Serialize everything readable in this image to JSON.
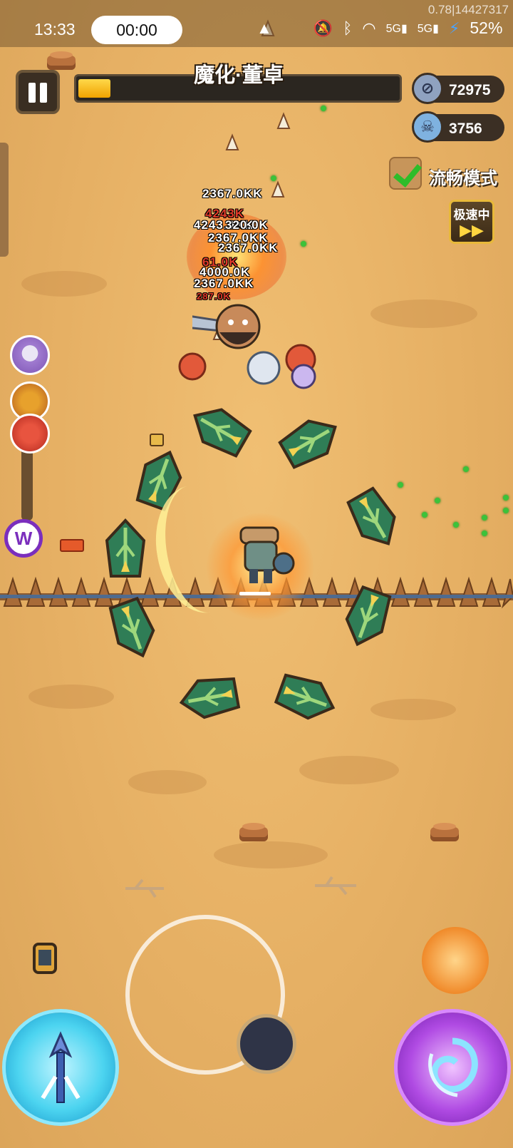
{
  "status_bar": {
    "time": "13:33",
    "recording_timer": "00:00",
    "battery": "52%",
    "debug": "0.78|14427317",
    "icons": [
      "app-icon",
      "mute-icon",
      "bluetooth-icon",
      "wifi-icon",
      "signal-5g-icon",
      "signal-5g-icon",
      "charging-icon"
    ]
  },
  "hud": {
    "boss_name": "魔化·董卓",
    "boss_hp_fraction": 0.1,
    "coins": "72975",
    "kills": "3756",
    "smooth_mode_label": "流畅模式",
    "smooth_mode_enabled": true,
    "speed_label": "极速中",
    "speed_arrows": "▶▶"
  },
  "damage_numbers": [
    {
      "text": "2367.0KK",
      "color": "white"
    },
    {
      "text": "4243K",
      "color": "red"
    },
    {
      "text": "4243.0KK",
      "color": "white"
    },
    {
      "text": "320.0K",
      "color": "white"
    },
    {
      "text": "2367.0KK",
      "color": "white"
    },
    {
      "text": "2367.0KK",
      "color": "white"
    },
    {
      "text": "61.0K",
      "color": "red"
    },
    {
      "text": "4000.0K",
      "color": "white"
    },
    {
      "text": "2367.0KK",
      "color": "white"
    },
    {
      "text": "287.0K",
      "color": "red"
    }
  ],
  "pets": [
    "cat-pet",
    "lion-pet",
    "dragon-pet"
  ],
  "colors": {
    "ground": "#e8b466",
    "hp_fill": "#f0a300",
    "accent_green": "#2dbd2a",
    "skill_blue": "#4cd4f0",
    "skill_purple": "#b04be3"
  }
}
